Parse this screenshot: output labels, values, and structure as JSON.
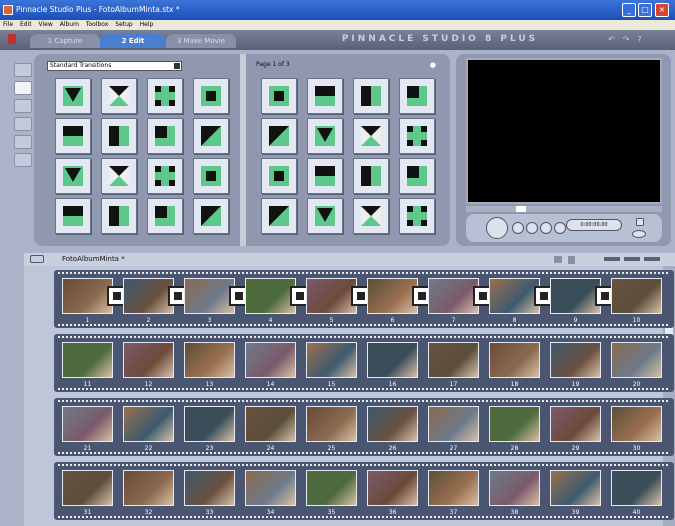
{
  "window": {
    "title": "Pinnacle Studio Plus - FotoAlbumMinta.stx *"
  },
  "menu": [
    "File",
    "Edit",
    "View",
    "Album",
    "Toolbox",
    "Setup",
    "Help"
  ],
  "tabs": [
    {
      "label": "1 Capture"
    },
    {
      "label": "2 Edit"
    },
    {
      "label": "3 Make Movie"
    }
  ],
  "brand": "PINNACLE STUDIO 8 PLUS",
  "header_icons": [
    "undo-icon",
    "redo-icon",
    "help-icon"
  ],
  "album": {
    "dropdown": "Standard Transitions",
    "page_label": "Page 1 of 3"
  },
  "preview": {
    "timecode": "0:00:00.00"
  },
  "project": {
    "name": "FotoAlbumMinta *"
  },
  "colors": {
    "accent_green": "#5cc98a",
    "frame_blue": "#4a5572",
    "tab_active": "#4a7fd0"
  },
  "clip_rows": [
    [
      "1",
      "2",
      "3",
      "4",
      "5",
      "6",
      "7",
      "8",
      "9",
      "10"
    ],
    [
      "11",
      "12",
      "13",
      "14",
      "15",
      "16",
      "17",
      "18",
      "19",
      "20"
    ],
    [
      "21",
      "22",
      "23",
      "24",
      "25",
      "26",
      "27",
      "28",
      "29",
      "30"
    ],
    [
      "31",
      "32",
      "33",
      "34",
      "35",
      "36",
      "37",
      "38",
      "39",
      "40"
    ]
  ]
}
